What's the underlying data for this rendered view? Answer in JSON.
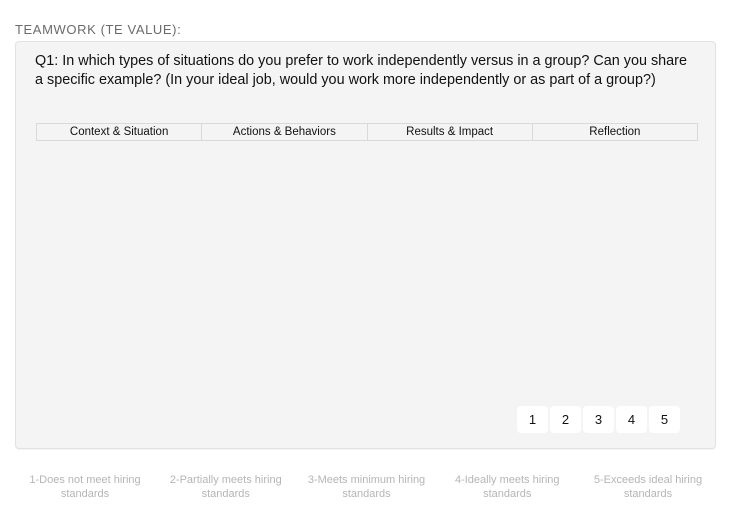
{
  "section": {
    "label": "TEAMWORK (TE VALUE):"
  },
  "question": {
    "text": "Q1: In which types of situations do you prefer to work independently versus in a group? Can you share a specific example? (In your ideal job, would you work more independently or as part of a group?)",
    "columns": [
      {
        "label": "Context & Situation"
      },
      {
        "label": "Actions & Behaviors"
      },
      {
        "label": "Results & Impact"
      },
      {
        "label": "Reflection"
      }
    ],
    "rating_options": [
      {
        "label": "1"
      },
      {
        "label": "2"
      },
      {
        "label": "3"
      },
      {
        "label": "4"
      },
      {
        "label": "5"
      }
    ]
  },
  "scale_legend": [
    {
      "label": "1-Does not meet hiring standards"
    },
    {
      "label": "2-Partially meets hiring standards"
    },
    {
      "label": "3-Meets minimum hiring standards"
    },
    {
      "label": "4-Ideally meets hiring standards"
    },
    {
      "label": "5-Exceeds ideal hiring standards"
    }
  ]
}
